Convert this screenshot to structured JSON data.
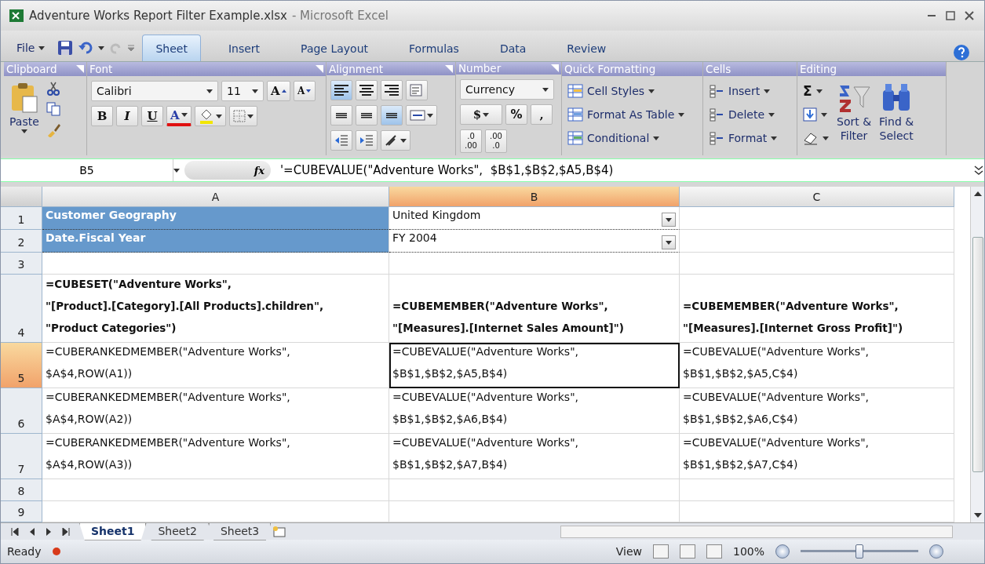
{
  "window": {
    "title": "Adventure Works Report Filter Example.xlsx",
    "app": " - Microsoft Excel"
  },
  "file_menu": "File",
  "tabs": [
    {
      "label": "Sheet",
      "selected": true
    },
    {
      "label": "Insert",
      "selected": false
    },
    {
      "label": "Page Layout",
      "selected": false
    },
    {
      "label": "Formulas",
      "selected": false
    },
    {
      "label": "Data",
      "selected": false
    },
    {
      "label": "Review",
      "selected": false
    }
  ],
  "ribbon": {
    "clipboard": {
      "name": "Clipboard",
      "launcher": true,
      "paste": "Paste"
    },
    "font": {
      "name": "Font",
      "launcher": true,
      "font_name": "Calibri",
      "font_size": "11",
      "grow": "A",
      "shrink": "A",
      "bold": "B",
      "italic": "I",
      "underline": "U",
      "font_color": "A"
    },
    "alignment": {
      "name": "Alignment",
      "launcher": true,
      "align": [
        {
          "selected": true
        },
        {
          "selected": false
        },
        {
          "selected": false
        }
      ],
      "valign": [
        {
          "selected": false
        },
        {
          "selected": false
        },
        {
          "selected": true
        }
      ]
    },
    "number": {
      "name": "Number",
      "launcher": true,
      "format": "Currency",
      "currency": "$",
      "percent": "%",
      "comma": ",",
      "increase_decimal": [
        ".0",
        ".00"
      ],
      "decrease_decimal": [
        ".00",
        ".0"
      ]
    },
    "quick": {
      "name": "Quick Formatting",
      "launcher": false,
      "items": [
        "Cell Styles",
        "Format As Table",
        "Conditional"
      ]
    },
    "cells": {
      "name": "Cells",
      "launcher": false,
      "items": [
        "Insert",
        "Delete",
        "Format"
      ]
    },
    "editing": {
      "name": "Editing",
      "launcher": false,
      "sum": "Σ",
      "sort": [
        "Sort &",
        "Filter"
      ],
      "find": [
        "Find &",
        "Select"
      ]
    }
  },
  "formula_bar": {
    "name_box": "B5",
    "function_label": "fx",
    "formula": "'=CUBEVALUE(\"Adventure Works\",  $B$1,$B$2,$A5,B$4)"
  },
  "columns": [
    {
      "label": "A",
      "selected": false
    },
    {
      "label": "B",
      "selected": true
    },
    {
      "label": "C",
      "selected": false
    }
  ],
  "rows": [
    {
      "label": "1",
      "selected": false,
      "cells": [
        {
          "text": "Customer Geography",
          "kind": "header",
          "selected": false
        },
        {
          "text": "United Kingdom",
          "kind": "dropdown",
          "selected": false
        },
        {
          "kind": "empty",
          "selected": false
        }
      ]
    },
    {
      "label": "2",
      "selected": false,
      "cells": [
        {
          "text": "Date.Fiscal Year",
          "kind": "header",
          "selected": false
        },
        {
          "text": "FY 2004",
          "kind": "dropdown",
          "selected": false
        },
        {
          "kind": "empty",
          "selected": false
        }
      ]
    },
    {
      "label": "3",
      "selected": false,
      "cells": [
        {
          "kind": "empty",
          "selected": false
        },
        {
          "kind": "empty",
          "selected": false
        },
        {
          "kind": "empty",
          "selected": false
        }
      ]
    },
    {
      "label": "4",
      "selected": false,
      "cells": [
        {
          "text": "=CUBESET(\"Adventure Works\",\n\"[Product].[Category].[All Products].children\",\n\"Product Categories\")",
          "kind": "bold",
          "selected": false
        },
        {
          "text": "=CUBEMEMBER(\"Adventure Works\",\n\"[Measures].[Internet Sales Amount]\")",
          "kind": "bold",
          "selected": false
        },
        {
          "text": "=CUBEMEMBER(\"Adventure Works\",\n\"[Measures].[Internet Gross Profit]\")",
          "kind": "bold",
          "selected": false
        }
      ]
    },
    {
      "label": "5",
      "selected": true,
      "cells": [
        {
          "text": "=CUBERANKEDMEMBER(\"Adventure Works\",\n$A$4,ROW(A1))",
          "kind": "plain",
          "selected": false
        },
        {
          "text": "=CUBEVALUE(\"Adventure Works\",\n$B$1,$B$2,$A5,B$4)",
          "kind": "plain",
          "selected": true
        },
        {
          "text": "=CUBEVALUE(\"Adventure Works\",\n$B$1,$B$2,$A5,C$4)",
          "kind": "plain",
          "selected": false
        }
      ]
    },
    {
      "label": "6",
      "selected": false,
      "cells": [
        {
          "text": "=CUBERANKEDMEMBER(\"Adventure Works\",\n$A$4,ROW(A2))",
          "kind": "plain",
          "selected": false
        },
        {
          "text": "=CUBEVALUE(\"Adventure Works\",\n$B$1,$B$2,$A6,B$4)",
          "kind": "plain",
          "selected": false
        },
        {
          "text": "=CUBEVALUE(\"Adventure Works\",\n$B$1,$B$2,$A6,C$4)",
          "kind": "plain",
          "selected": false
        }
      ]
    },
    {
      "label": "7",
      "selected": false,
      "cells": [
        {
          "text": "=CUBERANKEDMEMBER(\"Adventure Works\",\n$A$4,ROW(A3))",
          "kind": "plain",
          "selected": false
        },
        {
          "text": "=CUBEVALUE(\"Adventure Works\",\n$B$1,$B$2,$A7,B$4)",
          "kind": "plain",
          "selected": false
        },
        {
          "text": "=CUBEVALUE(\"Adventure Works\",\n$B$1,$B$2,$A7,C$4)",
          "kind": "plain",
          "selected": false
        }
      ]
    },
    {
      "label": "8",
      "selected": false,
      "cells": [
        {
          "kind": "empty",
          "selected": false
        },
        {
          "kind": "empty",
          "selected": false
        },
        {
          "kind": "empty",
          "selected": false
        }
      ]
    },
    {
      "label": "9",
      "selected": false,
      "cells": [
        {
          "kind": "empty",
          "selected": false
        },
        {
          "kind": "empty",
          "selected": false
        },
        {
          "kind": "empty",
          "selected": false
        }
      ]
    }
  ],
  "sheets": [
    {
      "label": "Sheet1",
      "selected": true
    },
    {
      "label": "Sheet2",
      "selected": false
    },
    {
      "label": "Sheet3",
      "selected": false
    }
  ],
  "status_bar": {
    "status": "Ready",
    "view": "View",
    "zoom": "100%",
    "level": 0.5
  }
}
